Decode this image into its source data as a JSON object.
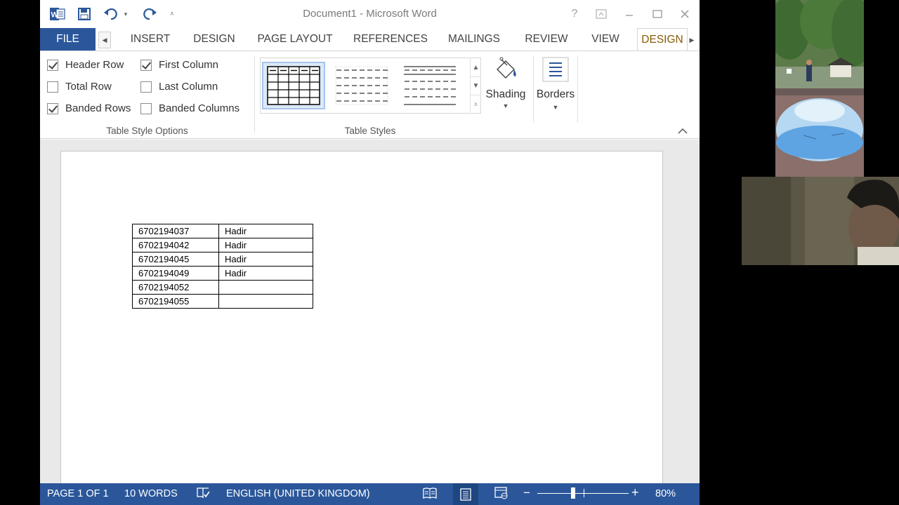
{
  "window": {
    "title": "Document1 - Microsoft Word"
  },
  "quick_access": {
    "icons": [
      "word-icon",
      "save-icon",
      "undo-icon",
      "redo-icon",
      "customize-icon"
    ]
  },
  "title_buttons": {
    "help": "?"
  },
  "tabs": [
    {
      "label": "FILE"
    },
    {
      "label": "INSERT"
    },
    {
      "label": "DESIGN"
    },
    {
      "label": "PAGE LAYOUT"
    },
    {
      "label": "REFERENCES"
    },
    {
      "label": "MAILINGS"
    },
    {
      "label": "REVIEW"
    },
    {
      "label": "VIEW"
    },
    {
      "label": "DESIGN"
    }
  ],
  "ribbon": {
    "table_style_options": {
      "label": "Table Style Options",
      "options": [
        {
          "label": "Header Row",
          "checked": true
        },
        {
          "label": "Total Row",
          "checked": false
        },
        {
          "label": "Banded Rows",
          "checked": true
        },
        {
          "label": "First Column",
          "checked": true
        },
        {
          "label": "Last Column",
          "checked": false
        },
        {
          "label": "Banded Columns",
          "checked": false
        }
      ]
    },
    "table_styles": {
      "label": "Table Styles"
    },
    "shading_label": "Shading",
    "borders_label": "Borders"
  },
  "document": {
    "table": [
      [
        "6702194037",
        "Hadir"
      ],
      [
        "6702194042",
        "Hadir"
      ],
      [
        "6702194045",
        "Hadir"
      ],
      [
        "6702194049",
        "Hadir"
      ],
      [
        "6702194052",
        ""
      ],
      [
        "6702194055",
        ""
      ]
    ]
  },
  "status": {
    "page": "PAGE 1 OF 1",
    "words": "10 WORDS",
    "language": "ENGLISH (UNITED KINGDOM)",
    "zoom": "80%",
    "zoom_value": 80
  },
  "colors": {
    "accent": "#2b579a",
    "active_tab": "#8a5a00"
  }
}
